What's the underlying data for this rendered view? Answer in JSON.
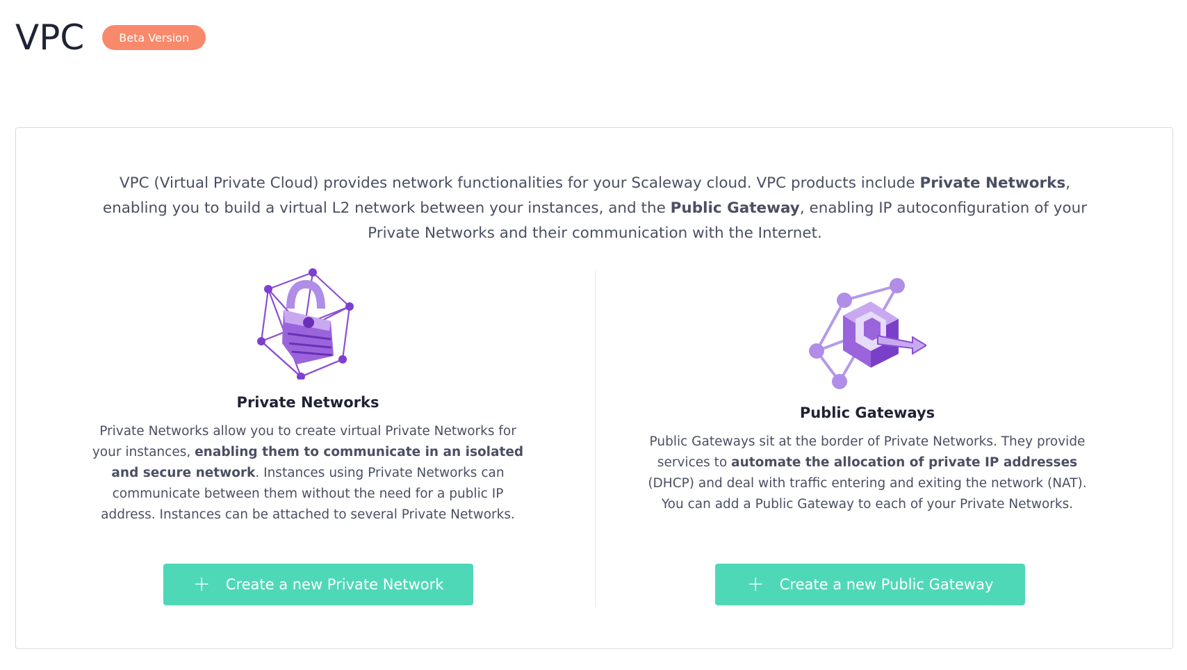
{
  "header": {
    "title": "VPC",
    "badge": "Beta Version"
  },
  "intro": {
    "p1": "VPC (Virtual Private Cloud) provides network functionalities for your Scaleway cloud. VPC products include ",
    "b1": "Private Networks",
    "p2": ", enabling you to build a virtual L2 network between your instances, and the ",
    "b2": "Public Gateway",
    "p3": ", enabling IP autoconfiguration of your Private Networks and their communication with the Internet."
  },
  "private_networks": {
    "icon": "lock-network-illustration",
    "title": "Private Networks",
    "d1": "Private Networks allow you to create virtual Private Networks for your instances, ",
    "b1": "enabling them to communicate in an isolated and secure network",
    "d2": ". Instances using Private Networks can communicate between them without the need for a public IP address. Instances can be attached to several Private Networks.",
    "button_icon": "plus-icon",
    "button_label": "Create a new Private Network"
  },
  "public_gateways": {
    "icon": "gateway-cube-illustration",
    "title": "Public Gateways",
    "d1": "Public Gateways sit at the border of Private Networks. They provide services to ",
    "b1": "automate the allocation of private IP addresses",
    "d2": " (DHCP) and deal with traffic entering and exiting the network (NAT). You can add a Public Gateway to each of your Private Networks.",
    "button_icon": "plus-icon",
    "button_label": "Create a new Public Gateway"
  },
  "colors": {
    "accent": "#4fd8b8",
    "badge": "#f9896b",
    "illustration": "#8a4fd1"
  }
}
